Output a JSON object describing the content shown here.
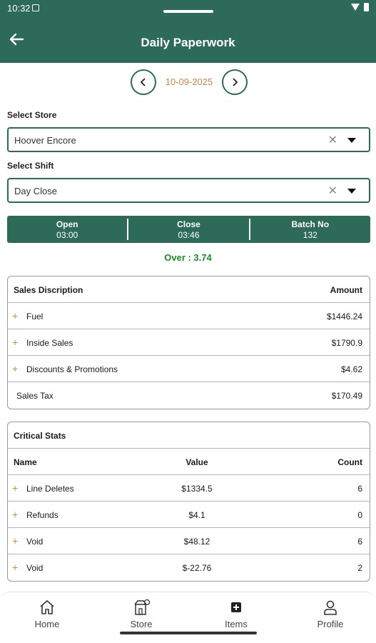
{
  "status": {
    "time": "10:32"
  },
  "header": {
    "title": "Daily Paperwork"
  },
  "date_nav": {
    "date": "10-09-2025"
  },
  "store": {
    "label": "Select Store",
    "value": "Hoover Encore"
  },
  "shift": {
    "label": "Select Shift",
    "value": "Day Close"
  },
  "shift_info": {
    "open_label": "Open",
    "open_value": "03:00",
    "close_label": "Close",
    "close_value": "03:46",
    "batch_label": "Batch No",
    "batch_value": "132"
  },
  "over_text": "Over : 3.74",
  "sales": {
    "header_desc": "Sales Discription",
    "header_amount": "Amount",
    "rows": [
      {
        "desc": "Fuel",
        "amount": "$1446.24"
      },
      {
        "desc": "Inside Sales",
        "amount": "$1790.9"
      },
      {
        "desc": "Discounts & Promotions",
        "amount": "$4.62"
      },
      {
        "desc": "Sales Tax",
        "amount": "$170.49"
      }
    ]
  },
  "critical": {
    "title": "Critical Stats",
    "col_name": "Name",
    "col_value": "Value",
    "col_count": "Count",
    "rows": [
      {
        "name": "Line Deletes",
        "value": "$1334.5",
        "count": "6"
      },
      {
        "name": "Refunds",
        "value": "$4.1",
        "count": "0"
      },
      {
        "name": "Void",
        "value": "$48.12",
        "count": "6"
      },
      {
        "name": "Void",
        "value": "$-22.76",
        "count": "2"
      }
    ]
  },
  "nav": {
    "home": "Home",
    "store": "Store",
    "items": "Items",
    "profile": "Profile"
  },
  "colors": {
    "primary": "#2d6a57",
    "accent": "#c9894a",
    "over_green": "#1b8a2b"
  },
  "icons": {
    "back": "arrow-left-icon",
    "prev": "chevron-left-icon",
    "next": "chevron-right-icon",
    "add": "plus-icon",
    "clear": "close-icon",
    "dropdown": "caret-down-icon"
  }
}
